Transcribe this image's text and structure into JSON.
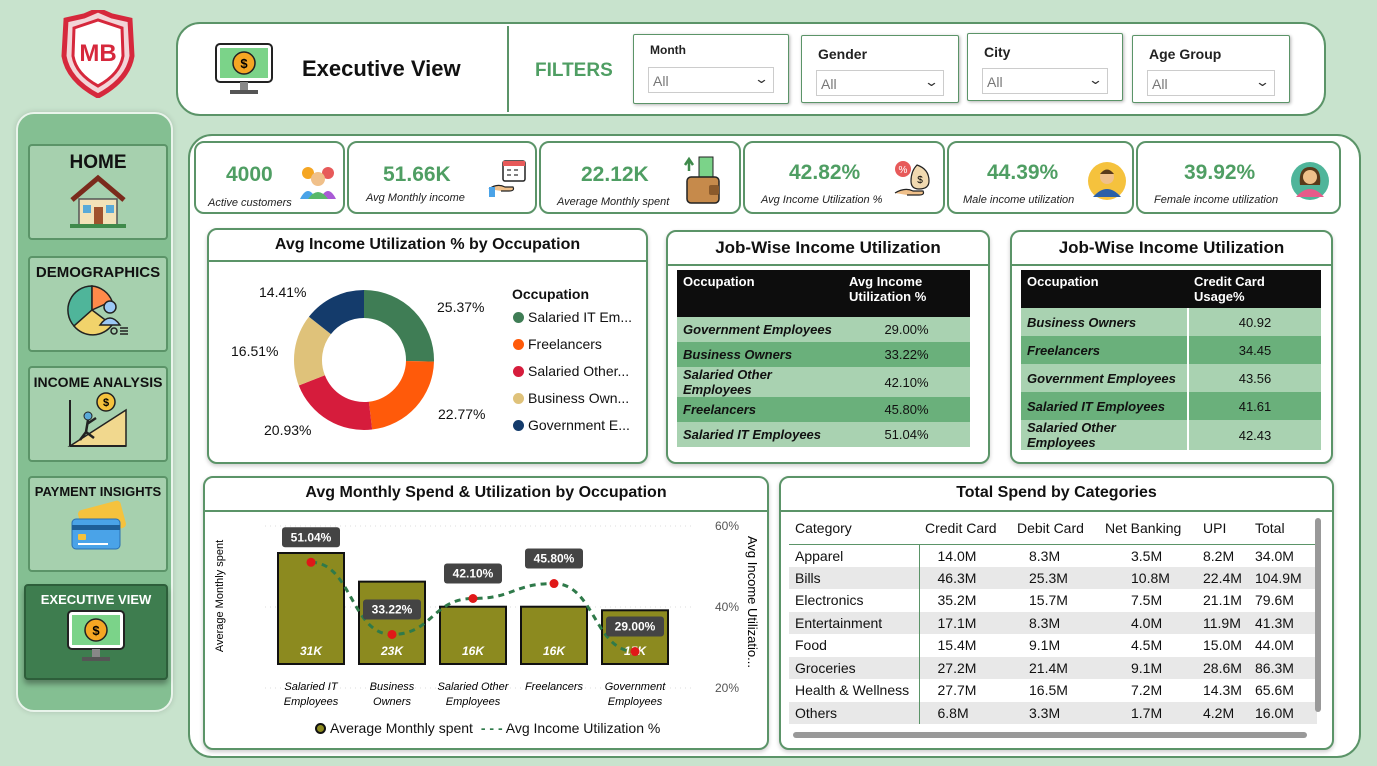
{
  "app": {
    "logo": "MB",
    "page_title": "Executive View",
    "filters_label": "FILTERS"
  },
  "nav": [
    {
      "label": "HOME",
      "icon": "house-icon"
    },
    {
      "label": "DEMOGRAPHICS",
      "icon": "pie-person-icon"
    },
    {
      "label": "INCOME ANALYSIS",
      "icon": "growth-stairs-icon"
    },
    {
      "label": "PAYMENT INSIGHTS",
      "icon": "credit-card-icon"
    },
    {
      "label": "EXECUTIVE VIEW",
      "icon": "monitor-dollar-icon"
    }
  ],
  "filters": [
    {
      "label": "Month",
      "value": "All"
    },
    {
      "label": "Gender",
      "value": "All"
    },
    {
      "label": "City",
      "value": "All"
    },
    {
      "label": "Age Group",
      "value": "All"
    }
  ],
  "kpis": [
    {
      "value": "4000",
      "label": "Active customers",
      "icon": "people-icon"
    },
    {
      "value": "51.66K",
      "label": "Avg Monthly income",
      "icon": "calendar-money-icon"
    },
    {
      "value": "22.12K",
      "label": "Average Monthly spent",
      "icon": "wallet-icon"
    },
    {
      "value": "42.82%",
      "label": "Avg Income Utilization %",
      "icon": "money-bag-hand-icon"
    },
    {
      "value": "44.39%",
      "label": "Male income utilization",
      "icon": "male-avatar-icon"
    },
    {
      "value": "39.92%",
      "label": "Female income utilization",
      "icon": "female-avatar-icon"
    }
  ],
  "donut": {
    "title": "Avg Income Utilization % by Occupation",
    "legend_title": "Occupation",
    "legend": [
      "Salaried IT Em...",
      "Freelancers",
      "Salaried Other...",
      "Business Own...",
      "Government E..."
    ],
    "labels": [
      "25.37%",
      "22.77%",
      "20.93%",
      "16.51%",
      "14.41%"
    ]
  },
  "job_table1": {
    "title": "Job-Wise Income Utilization",
    "headers": [
      "Occupation",
      "Avg Income Utilization %"
    ],
    "rows": [
      [
        "Government Employees",
        "29.00%"
      ],
      [
        "Business Owners",
        "33.22%"
      ],
      [
        "Salaried Other Employees",
        "42.10%"
      ],
      [
        "Freelancers",
        "45.80%"
      ],
      [
        "Salaried IT Employees",
        "51.04%"
      ]
    ]
  },
  "job_table2": {
    "title": "Job-Wise Income Utilization",
    "headers": [
      "Occupation",
      "Credit Card Usage%"
    ],
    "rows": [
      [
        "Business Owners",
        "40.92"
      ],
      [
        "Freelancers",
        "34.45"
      ],
      [
        "Government Employees",
        "43.56"
      ],
      [
        "Salaried IT Employees",
        "41.61"
      ],
      [
        "Salaried Other Employees",
        "42.43"
      ]
    ]
  },
  "combo": {
    "title": "Avg Monthly Spend & Utilization by Occupation",
    "y_left_label": "Average Monthly spent",
    "y_right_label": "Avg Income Utilizatio...",
    "right_ticks": [
      "60%",
      "40%",
      "20%"
    ],
    "legend_bar": "Average Monthly spent",
    "legend_line": "Avg Income Utilization %"
  },
  "spend_table": {
    "title": "Total Spend by Categories",
    "headers": [
      "Category",
      "Credit Card",
      "Debit Card",
      "Net Banking",
      "UPI",
      "Total"
    ],
    "rows": [
      [
        "Apparel",
        "14.0M",
        "8.3M",
        "3.5M",
        "8.2M",
        "34.0M"
      ],
      [
        "Bills",
        "46.3M",
        "25.3M",
        "10.8M",
        "22.4M",
        "104.9M"
      ],
      [
        "Electronics",
        "35.2M",
        "15.7M",
        "7.5M",
        "21.1M",
        "79.6M"
      ],
      [
        "Entertainment",
        "17.1M",
        "8.3M",
        "4.0M",
        "11.9M",
        "41.3M"
      ],
      [
        "Food",
        "15.4M",
        "9.1M",
        "4.5M",
        "15.0M",
        "44.0M"
      ],
      [
        "Groceries",
        "27.2M",
        "21.4M",
        "9.1M",
        "28.6M",
        "86.3M"
      ],
      [
        "Health & Wellness",
        "27.7M",
        "16.5M",
        "7.2M",
        "14.3M",
        "65.6M"
      ],
      [
        "Others",
        "6.8M",
        "3.3M",
        "1.7M",
        "4.2M",
        "16.0M"
      ]
    ]
  },
  "chart_data": [
    {
      "type": "pie",
      "title": "Avg Income Utilization % by Occupation",
      "legend_title": "Occupation",
      "categories": [
        "Salaried IT Employees",
        "Freelancers",
        "Salaried Other Employees",
        "Business Owners",
        "Government Employees"
      ],
      "values": [
        25.37,
        22.77,
        20.93,
        16.51,
        14.41
      ],
      "colors": [
        "#3f7d55",
        "#ff5a0a",
        "#d61c3c",
        "#dfc27a",
        "#143b6b"
      ],
      "legend_position": "right"
    },
    {
      "type": "bar",
      "title": "Avg Monthly Spend & Utilization by Occupation",
      "categories": [
        "Salaried IT Employees",
        "Business Owners",
        "Salaried Other Employees",
        "Freelancers",
        "Government Employees"
      ],
      "series": [
        {
          "name": "Average Monthly spent",
          "values": [
            31,
            23,
            16,
            16,
            15
          ],
          "unit": "K",
          "labels": [
            "31K",
            "23K",
            "16K",
            "16K",
            "15K"
          ],
          "color": "#8c8a1f"
        },
        {
          "name": "Avg Income Utilization %",
          "values": [
            51.04,
            33.22,
            42.1,
            45.8,
            29.0
          ],
          "labels": [
            "51.04%",
            "33.22%",
            "42.10%",
            "45.80%",
            "29.00%"
          ],
          "color": "#2f7a4a",
          "style": "dashed-line"
        }
      ],
      "ylabel": "Average Monthly spent",
      "y2label": "Avg Income Utilizatio...",
      "y2_ticks": [
        60,
        40,
        20
      ],
      "y2lim": [
        20,
        60
      ],
      "legend_position": "bottom"
    }
  ]
}
